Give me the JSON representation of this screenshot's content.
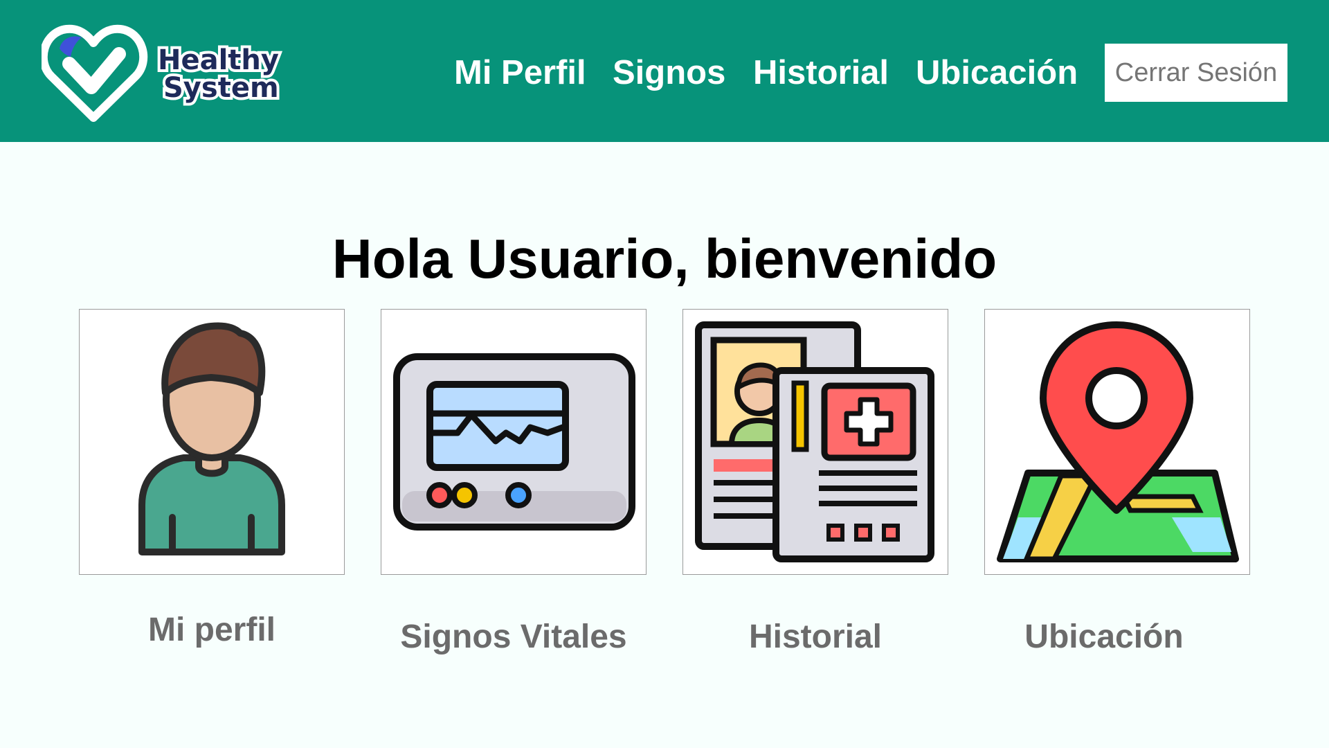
{
  "header": {
    "logo_line1": "Healthy",
    "logo_line2": "System",
    "nav": [
      {
        "label": "Mi Perfil"
      },
      {
        "label": "Signos"
      },
      {
        "label": "Historial"
      },
      {
        "label": "Ubicación"
      }
    ],
    "logout_label": "Cerrar Sesión"
  },
  "main": {
    "welcome": "Hola Usuario, bienvenido",
    "cards": [
      {
        "label": "Mi perfil",
        "icon": "user-profile-icon"
      },
      {
        "label": "Signos Vitales",
        "icon": "vital-signs-monitor-icon"
      },
      {
        "label": "Historial",
        "icon": "medical-record-icon"
      },
      {
        "label": "Ubicación",
        "icon": "map-location-pin-icon"
      }
    ]
  },
  "colors": {
    "header_bg": "#07937a",
    "page_bg": "#f7fffd",
    "label_gray": "#6b6b6b",
    "logo_navy": "#1e2a5a",
    "logo_blue": "#3f51d9"
  }
}
